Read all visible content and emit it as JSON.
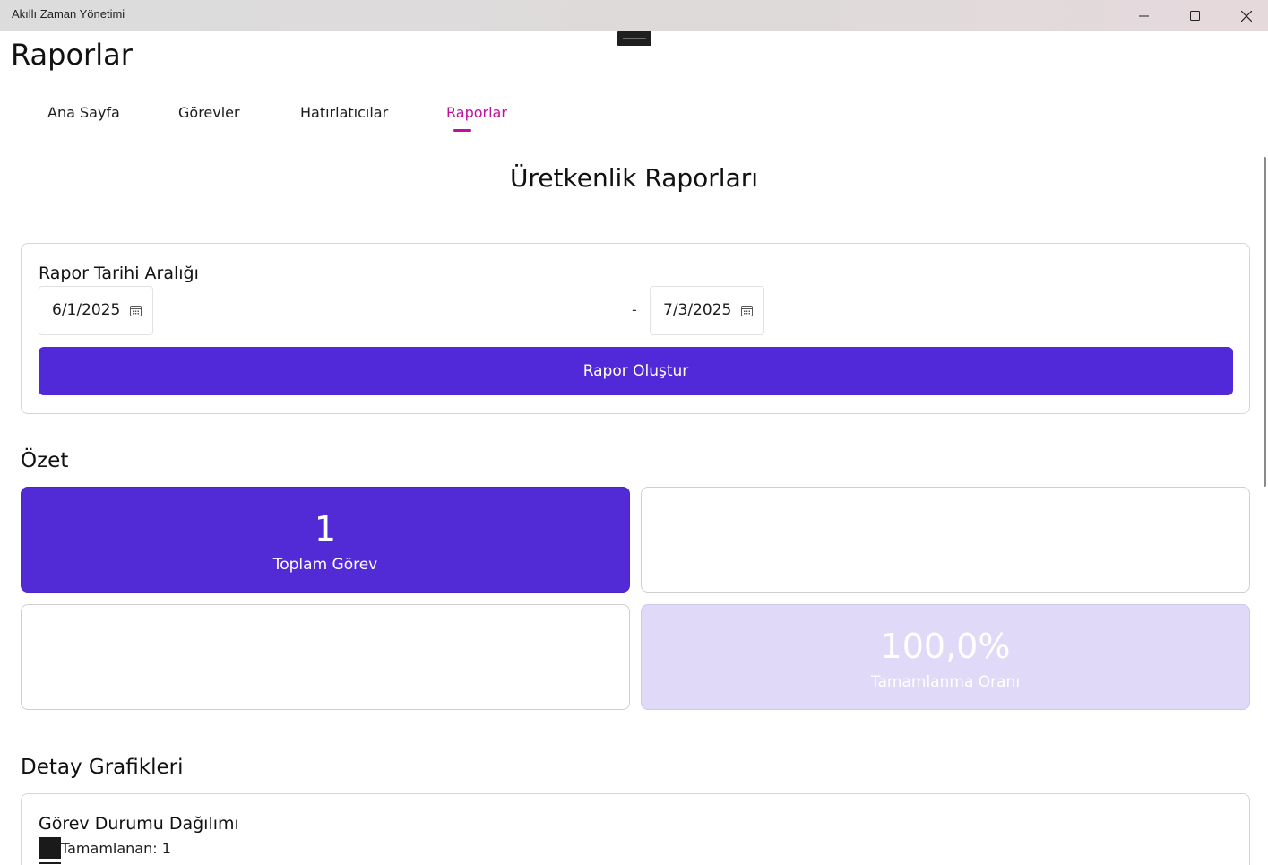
{
  "window": {
    "title": "Akıllı Zaman Yönetimi",
    "controls": [
      "minimize-icon",
      "maximize-icon",
      "close-icon"
    ]
  },
  "page": {
    "title": "Raporlar"
  },
  "nav": {
    "tabs": [
      {
        "label": "Ana Sayfa",
        "active": false
      },
      {
        "label": "Görevler",
        "active": false
      },
      {
        "label": "Hatırlatıcılar",
        "active": false
      },
      {
        "label": "Raporlar",
        "active": true
      }
    ],
    "active_color": "#c0109a"
  },
  "main": {
    "heading": "Üretkenlik Raporları",
    "date_range": {
      "label": "Rapor Tarihi Aralığı",
      "start": "6/1/2025",
      "separator": "-",
      "end": "7/3/2025",
      "calendar_icon": "calendar-icon"
    },
    "generate_button": "Rapor Oluştur",
    "accent_color": "#5229d9"
  },
  "summary": {
    "label": "Özet",
    "cards": [
      {
        "value": "1",
        "caption": "Toplam Görev"
      },
      {
        "value": "",
        "caption": ""
      },
      {
        "value": "",
        "caption": ""
      },
      {
        "value": "100,0%",
        "caption": "Tamamlanma Oranı"
      }
    ]
  },
  "details": {
    "label": "Detay Grafikleri",
    "chart": {
      "title": "Görev Durumu Dağılımı",
      "legend": [
        {
          "label": "Tamamlanan: 1",
          "color": "#1a1a1a"
        }
      ]
    }
  }
}
